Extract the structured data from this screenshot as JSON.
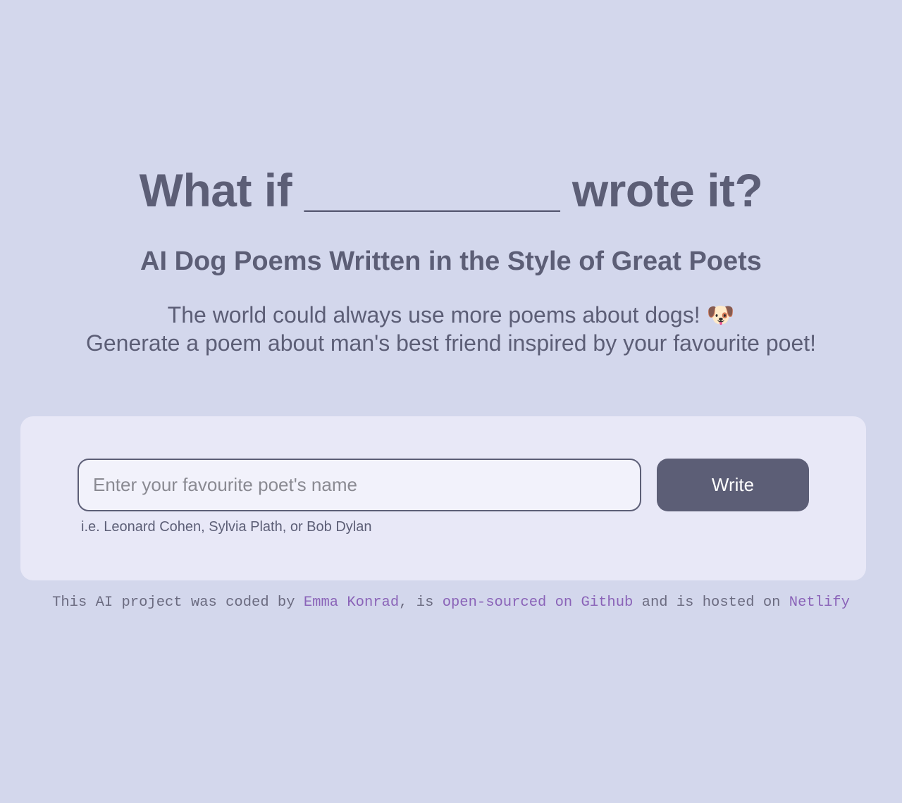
{
  "hero": {
    "title": "What if __________ wrote it?",
    "subtitle": "AI Dog Poems Written in the Style of Great Poets",
    "tagline_line1": "The world could always use more poems about dogs! 🐶",
    "tagline_line2": "Generate a poem about man's best friend inspired by your favourite poet!"
  },
  "form": {
    "input_placeholder": "Enter your favourite poet's name",
    "input_value": "",
    "submit_label": "Write",
    "hint": "i.e. Leonard Cohen, Sylvia Plath, or Bob Dylan"
  },
  "footer": {
    "text_1": "This AI project was coded by ",
    "author_link": "Emma Konrad",
    "text_2": ", is ",
    "github_link": "open-sourced on Github",
    "text_3": " and is hosted on ",
    "netlify_link": "Netlify"
  },
  "colors": {
    "background": "#d3d7ec",
    "card": "#e8e8f7",
    "text": "#5c5e76",
    "link": "#8a63b8",
    "button": "#5c5e76"
  }
}
